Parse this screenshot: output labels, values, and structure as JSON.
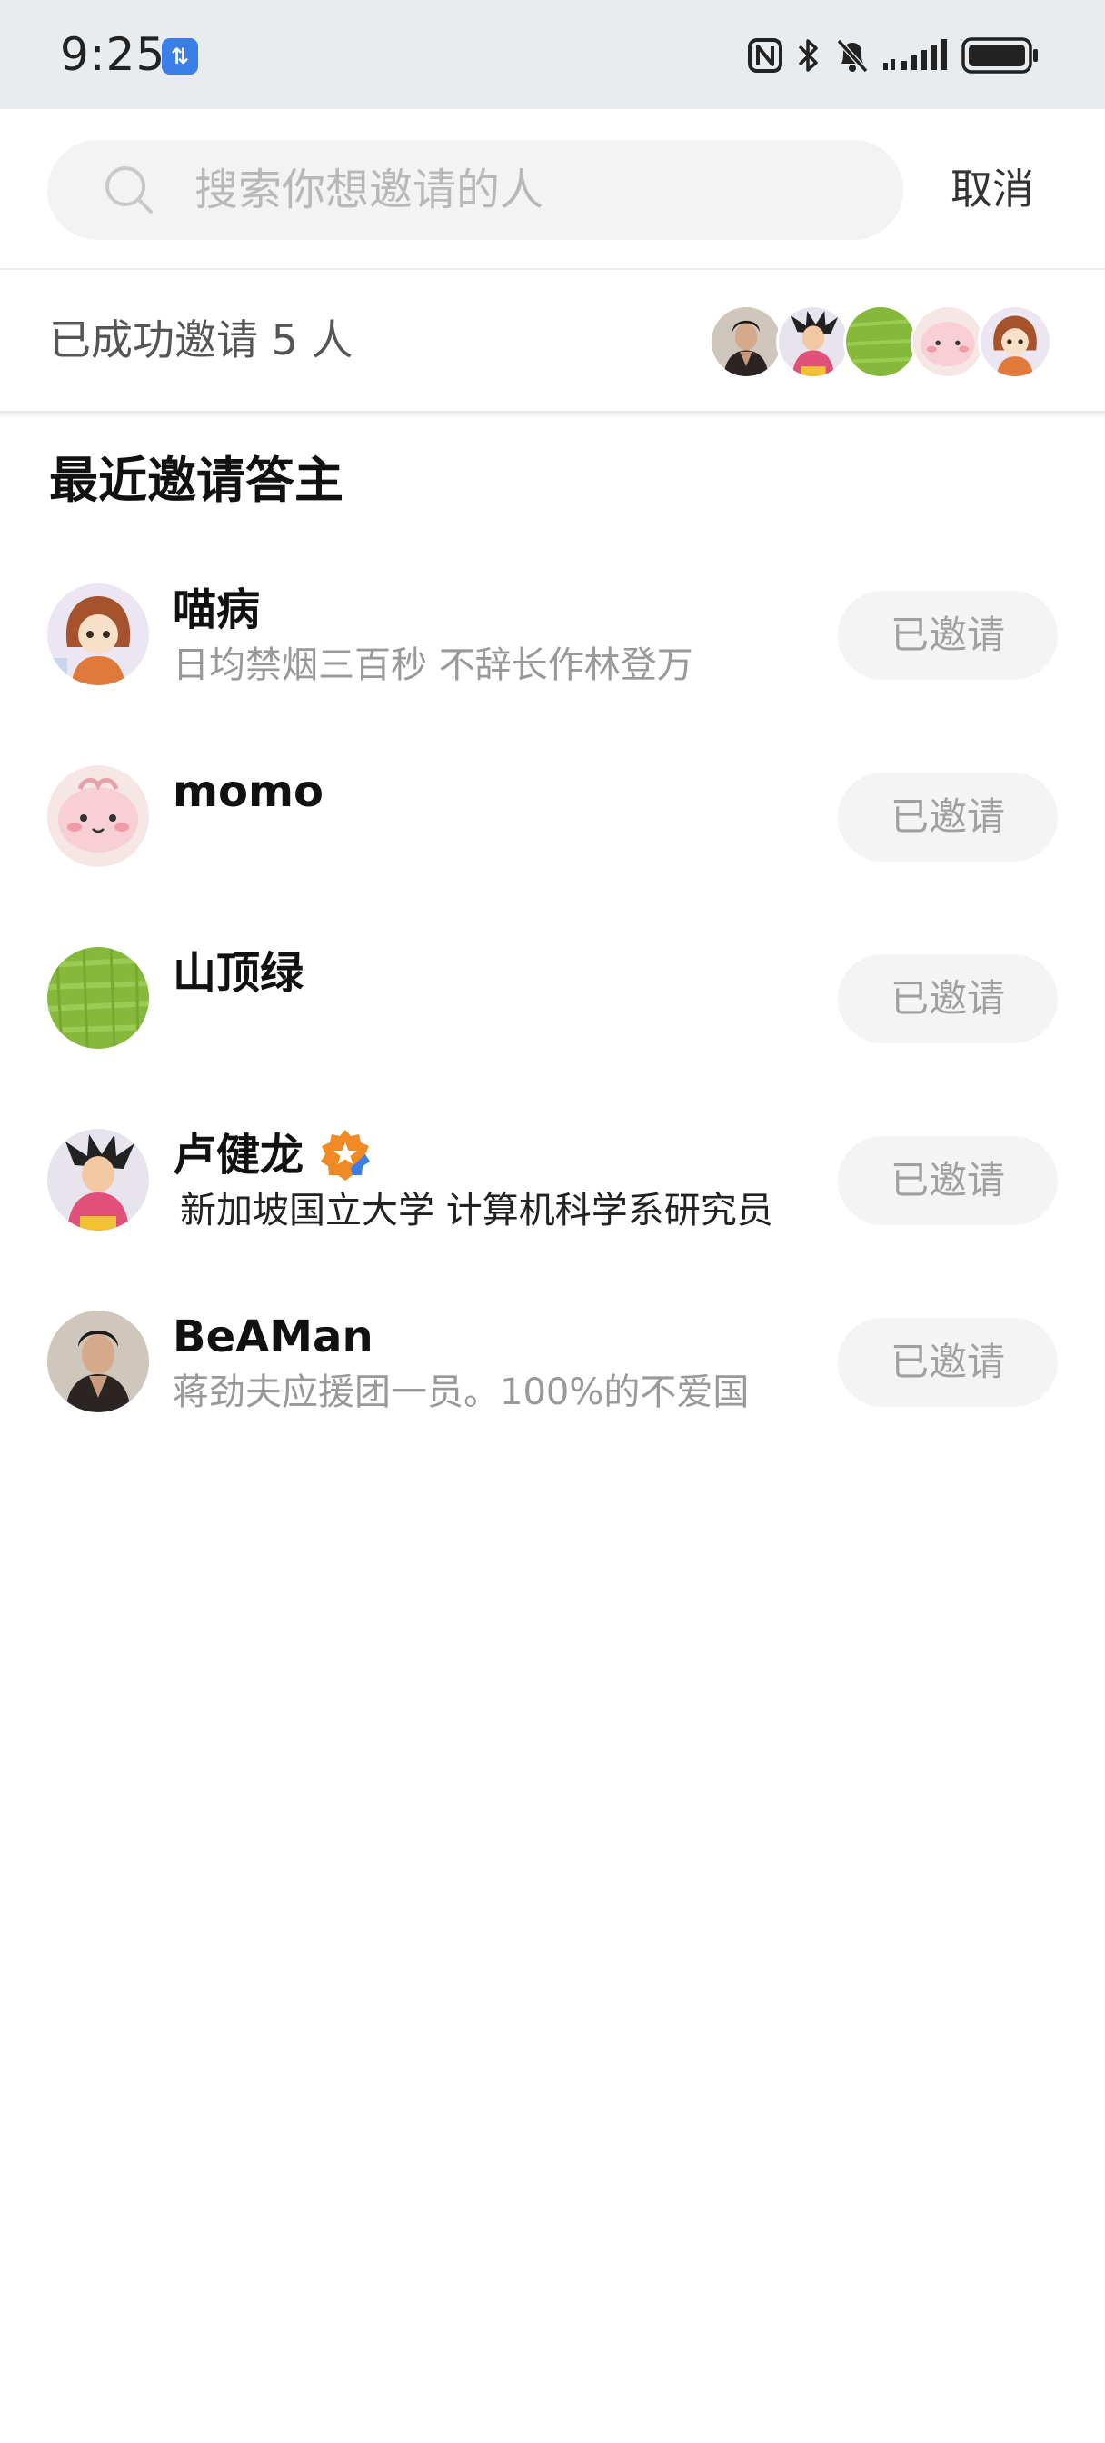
{
  "status_bar": {
    "time": "9:25",
    "app_badge": "⇅"
  },
  "search": {
    "placeholder": "搜索你想邀请的人",
    "value": "",
    "cancel_label": "取消"
  },
  "invited_summary": {
    "text": "已成功邀请 5 人",
    "avatars": [
      "beaman-avatar",
      "lu-jianlong-avatar",
      "shandinglv-avatar",
      "momo-avatar",
      "miaobing-avatar"
    ]
  },
  "section": {
    "title": "最近邀请答主"
  },
  "users": [
    {
      "name": "喵病",
      "bio": "日均禁烟三百秒 不辞长作林登万",
      "button": "已邀请",
      "verified": false
    },
    {
      "name": "momo",
      "bio": "",
      "button": "已邀请",
      "verified": false
    },
    {
      "name": "山顶绿",
      "bio": "",
      "button": "已邀请",
      "verified": false
    },
    {
      "name": "卢健龙",
      "bio": "新加坡国立大学 计算机科学系研究员",
      "button": "已邀请",
      "verified": true
    },
    {
      "name": "BeAMan",
      "bio": "蒋劲夫应援团一员。100%的不爱国",
      "button": "已邀请",
      "verified": false
    }
  ],
  "colors": {
    "status_bar_bg": "#e9ecef",
    "search_bg": "#f3f3f3",
    "button_bg": "#f4f4f4",
    "button_text": "#a0a0a0",
    "badge_orange": "#f08a24",
    "badge_blue": "#3a7ee8"
  }
}
